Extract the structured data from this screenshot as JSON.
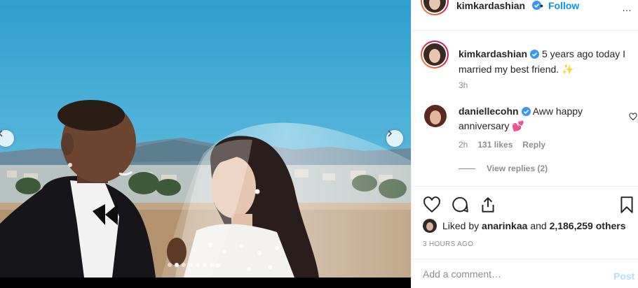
{
  "post": {
    "author": {
      "username": "kimkardashian",
      "verified_icon": "verified-badge-icon",
      "follow_label": "Follow",
      "bullet": "•",
      "more_label": "…"
    },
    "caption": {
      "username": "kimkardashian",
      "text": "5 years ago today I married my best friend. ✨",
      "time": "3h"
    },
    "comments": [
      {
        "username": "daniellecohn",
        "text": "Aww happy anniversary 💕",
        "time": "2h",
        "likes": "131 likes",
        "reply_label": "Reply",
        "view_replies": "View replies (2)"
      }
    ],
    "liked_by": {
      "prefix": "Liked by",
      "user": "anarinkaa",
      "joiner": "and",
      "others": "2,186,259 others"
    },
    "timestamp": "3 HOURS AGO",
    "comment_input": {
      "placeholder": "Add a comment…"
    },
    "post_button": "Post",
    "carousel": {
      "total": 8,
      "active_index": 1
    }
  },
  "colors": {
    "link_blue": "#0095f6",
    "post_disabled": "#b2dffc",
    "muted": "#8e8e8e",
    "verified": "#3897f0",
    "heart_emoji": "#ff4fa3",
    "sparkle": "#f5c518"
  }
}
